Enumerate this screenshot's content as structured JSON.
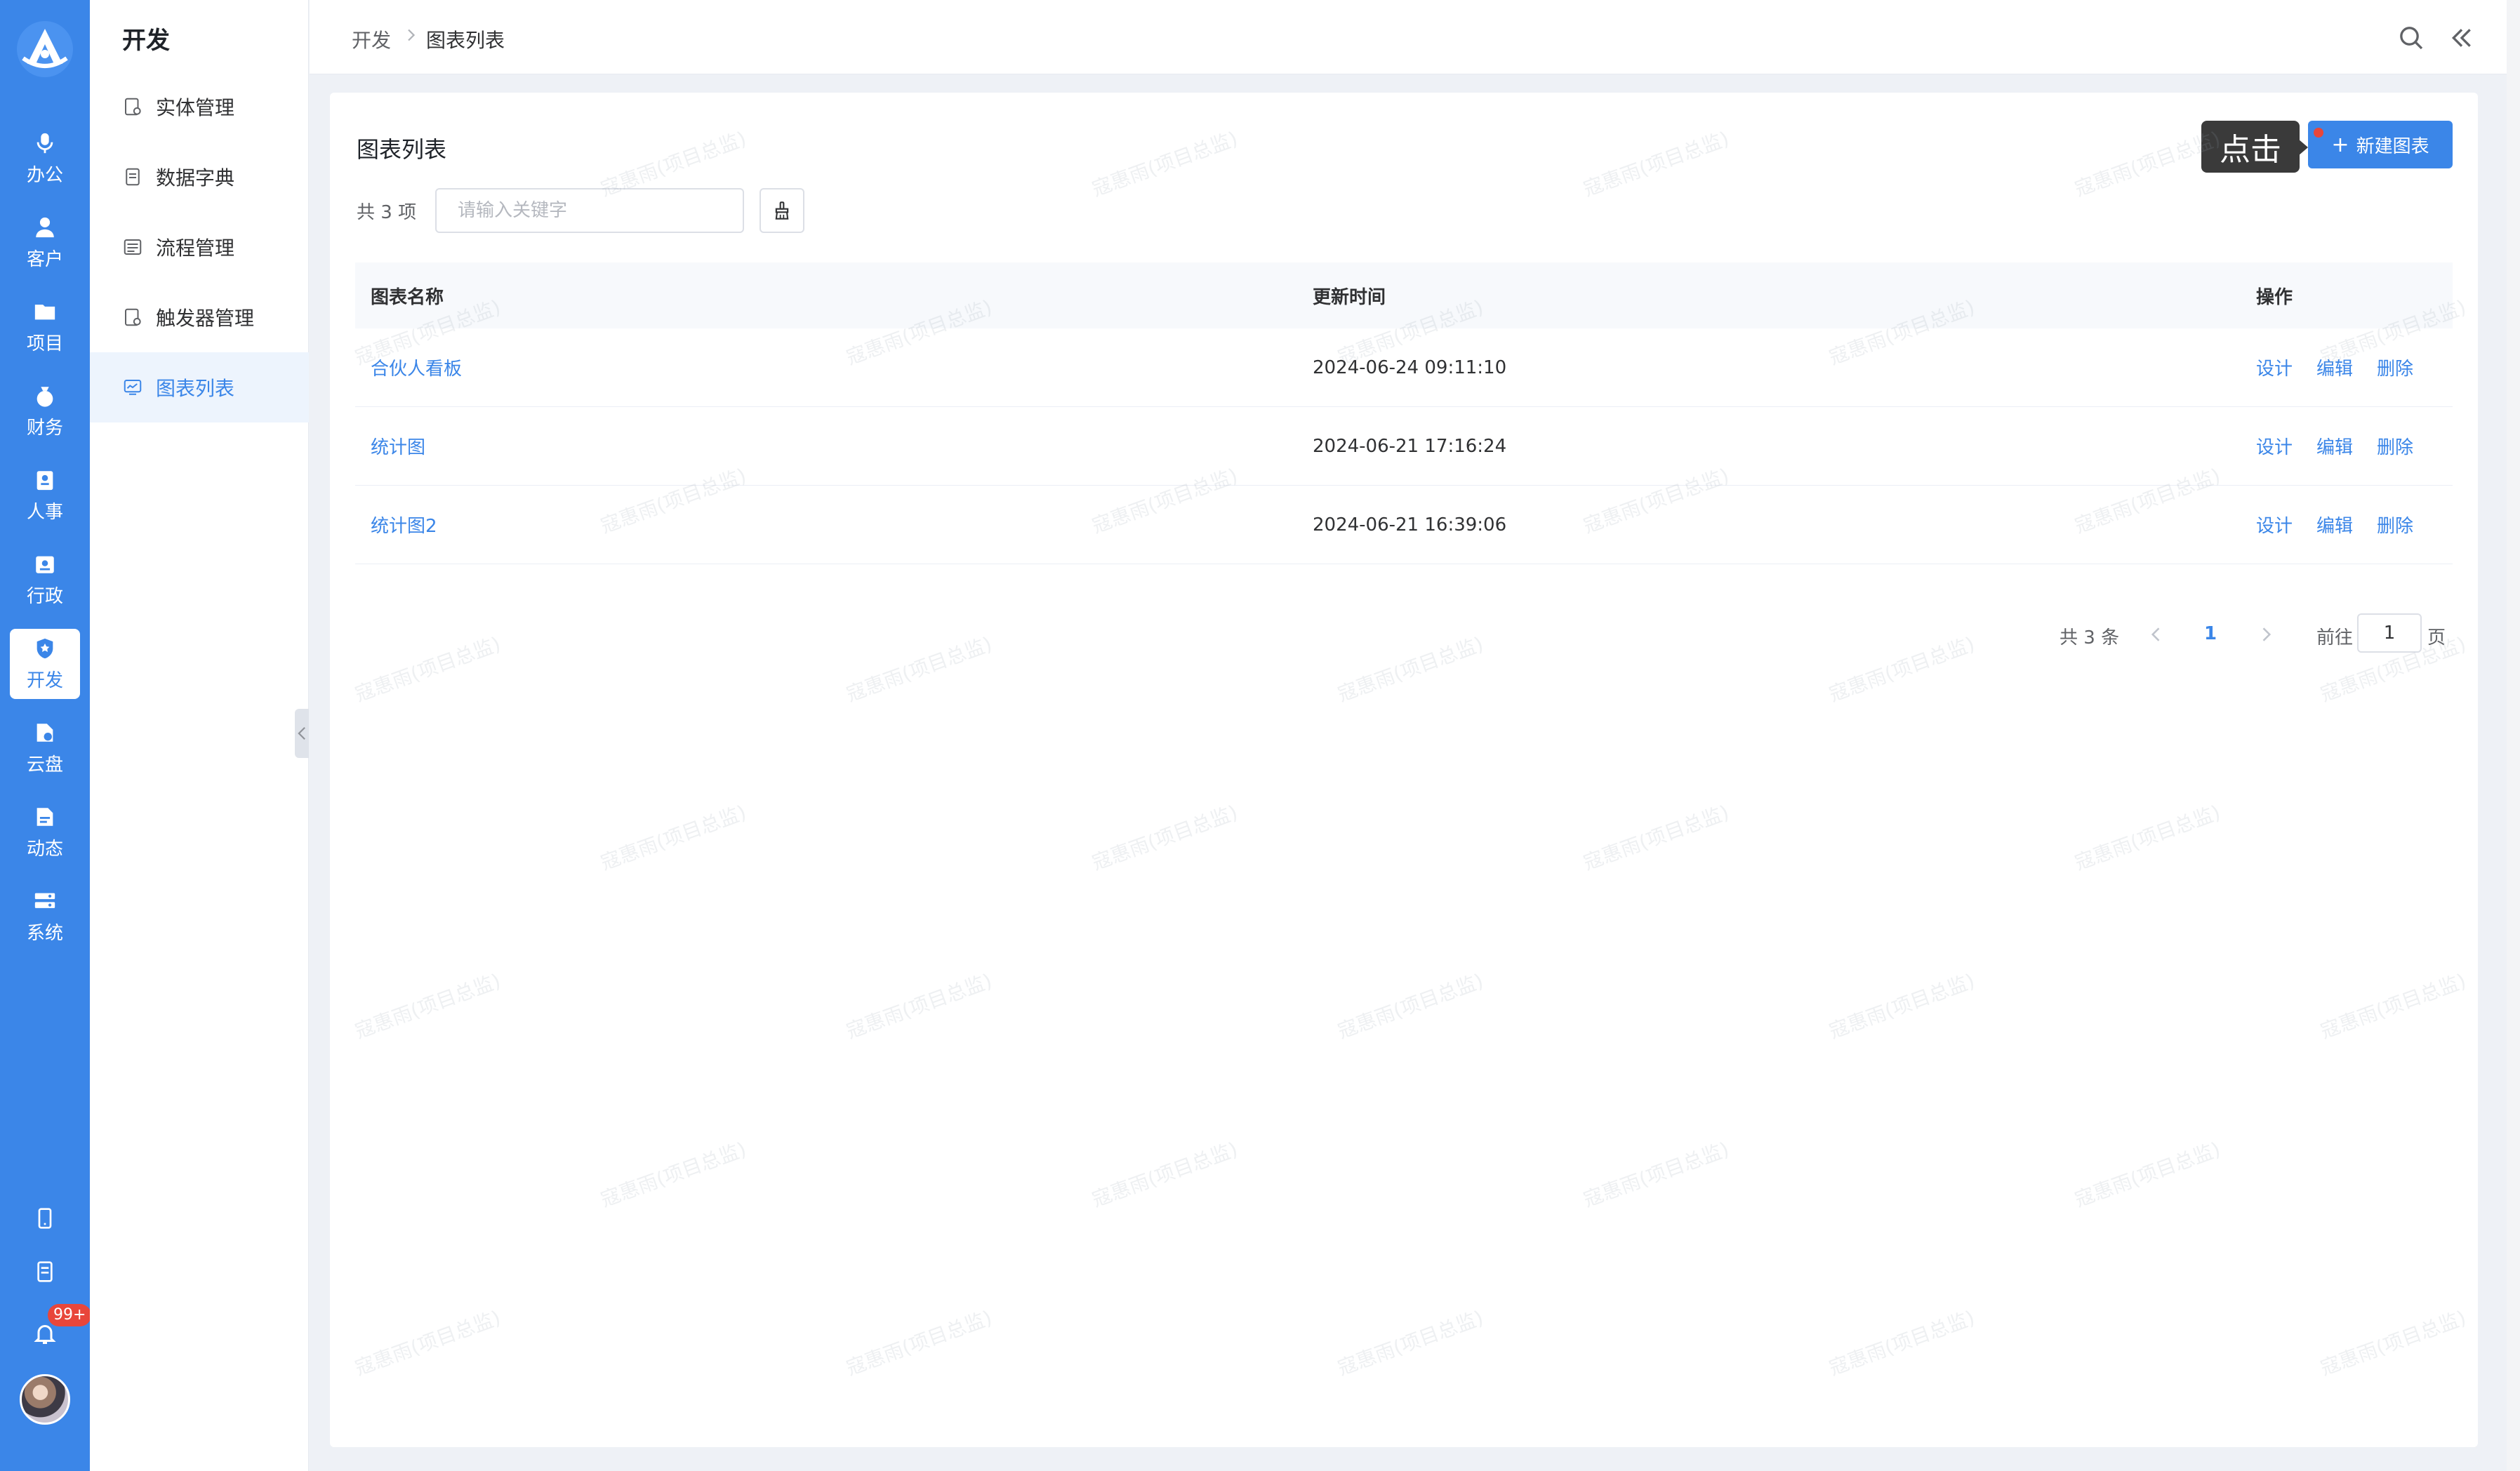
{
  "rail": {
    "items": [
      {
        "label": "办公",
        "icon": "mic-icon"
      },
      {
        "label": "客户",
        "icon": "customers-icon"
      },
      {
        "label": "项目",
        "icon": "folder-icon"
      },
      {
        "label": "财务",
        "icon": "money-bag-icon"
      },
      {
        "label": "人事",
        "icon": "id-badge-icon"
      },
      {
        "label": "行政",
        "icon": "admin-icon"
      },
      {
        "label": "开发",
        "icon": "dev-shield-icon",
        "active": true
      },
      {
        "label": "云盘",
        "icon": "cloud-drive-icon"
      },
      {
        "label": "动态",
        "icon": "feed-icon"
      },
      {
        "label": "系统",
        "icon": "system-icon"
      }
    ],
    "notification_count": "99+"
  },
  "submenu": {
    "title": "开发",
    "items": [
      {
        "label": "实体管理",
        "icon": "entity-icon"
      },
      {
        "label": "数据字典",
        "icon": "dictionary-icon"
      },
      {
        "label": "流程管理",
        "icon": "workflow-icon"
      },
      {
        "label": "触发器管理",
        "icon": "trigger-icon"
      },
      {
        "label": "图表列表",
        "icon": "chart-icon",
        "active": true
      }
    ]
  },
  "header": {
    "breadcrumb": [
      "开发",
      "图表列表"
    ]
  },
  "main": {
    "title": "图表列表",
    "total_label": "共 3 项",
    "search_placeholder": "请输入关键字",
    "new_button_label": "新建图表",
    "tooltip": "点击",
    "table": {
      "columns": [
        "图表名称",
        "更新时间",
        "操作"
      ],
      "rows": [
        {
          "name": "合伙人看板",
          "updated": "2024-06-24 09:11:10"
        },
        {
          "name": "统计图",
          "updated": "2024-06-21 17:16:24"
        },
        {
          "name": "统计图2",
          "updated": "2024-06-21 16:39:06"
        }
      ],
      "actions": [
        "设计",
        "编辑",
        "删除"
      ]
    },
    "pagination": {
      "total": "共 3 条",
      "current": "1",
      "goto_label": "前往",
      "page_input": "1",
      "page_suffix": "页"
    },
    "watermark": "寇惠雨(项目总监)"
  },
  "colors": {
    "primary": "#3b86e8",
    "badge": "#e8463a",
    "tooltip_bg": "#3a3a3a"
  }
}
